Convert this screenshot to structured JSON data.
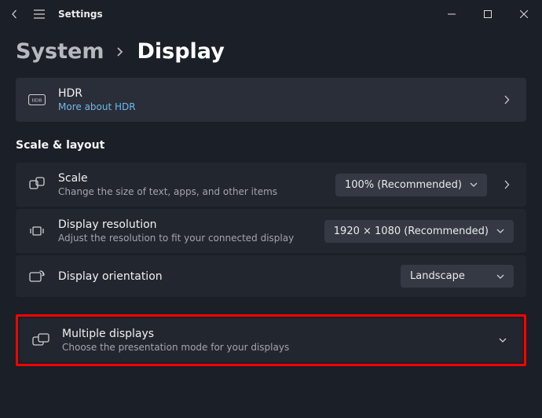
{
  "titlebar": {
    "app_name": "Settings"
  },
  "breadcrumb": {
    "parent": "System",
    "current": "Display"
  },
  "hdr_card": {
    "title": "HDR",
    "link": "More about HDR"
  },
  "section_scale_layout": {
    "heading": "Scale & layout"
  },
  "rows": {
    "scale": {
      "title": "Scale",
      "sub": "Change the size of text, apps, and other items",
      "value": "100% (Recommended)"
    },
    "resolution": {
      "title": "Display resolution",
      "sub": "Adjust the resolution to fit your connected display",
      "value": "1920 × 1080 (Recommended)"
    },
    "orientation": {
      "title": "Display orientation",
      "value": "Landscape"
    },
    "multiple": {
      "title": "Multiple displays",
      "sub": "Choose the presentation mode for your displays"
    }
  }
}
